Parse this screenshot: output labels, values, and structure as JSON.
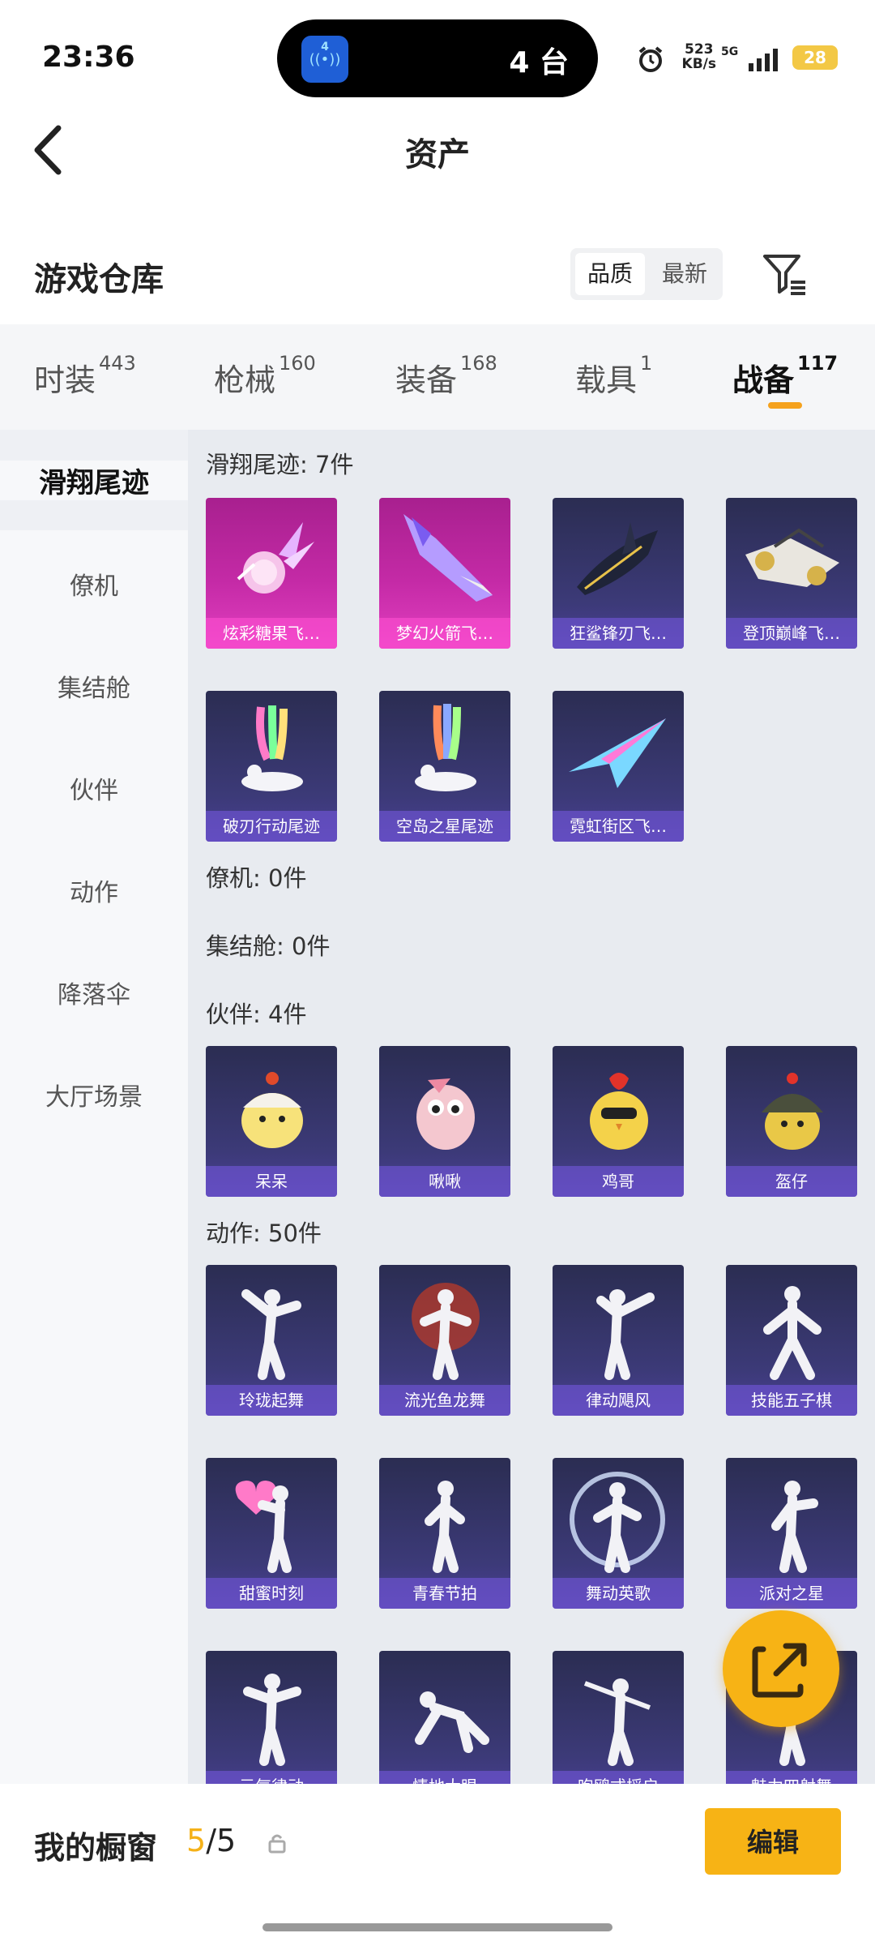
{
  "status_bar": {
    "time": "23:36",
    "island_icon_num": "4",
    "island_text": "4 台",
    "net_speed_value": "523",
    "net_speed_unit": "KB/s",
    "network": "5G",
    "battery": "28"
  },
  "header": {
    "title": "资产"
  },
  "warehouse": {
    "title": "游戏仓库",
    "sort_options": [
      "品质",
      "最新"
    ],
    "sort_active": "品质"
  },
  "tabs": [
    {
      "label": "时装",
      "count": "443"
    },
    {
      "label": "枪械",
      "count": "160"
    },
    {
      "label": "装备",
      "count": "168"
    },
    {
      "label": "载具",
      "count": "1"
    },
    {
      "label": "战备",
      "count": "117",
      "active": true
    }
  ],
  "side_nav": [
    {
      "label": "滑翔尾迹",
      "active": true
    },
    {
      "label": "僚机"
    },
    {
      "label": "集结舱"
    },
    {
      "label": "伙伴"
    },
    {
      "label": "动作"
    },
    {
      "label": "降落伞"
    },
    {
      "label": "大厅场景"
    }
  ],
  "sections": [
    {
      "header": "滑翔尾迹: 7件",
      "items": [
        "炫彩糖果飞…",
        "梦幻火箭飞…",
        "狂鲨锋刃飞…",
        "登顶巅峰飞…",
        "破刃行动尾迹",
        "空岛之星尾迹",
        "霓虹街区飞…"
      ]
    },
    {
      "header": "僚机: 0件",
      "items": []
    },
    {
      "header": "集结舱: 0件",
      "items": []
    },
    {
      "header": "伙伴: 4件",
      "items": [
        "呆呆",
        "啾啾",
        "鸡哥",
        "盔仔"
      ]
    },
    {
      "header": "动作: 50件",
      "items": [
        "玲珑起舞",
        "流光鱼龙舞",
        "律动飓风",
        "技能五子棋",
        "甜蜜时刻",
        "青春节拍",
        "舞动英歌",
        "派对之星",
        "元气律动",
        "情地大眼",
        "咆鸥式摇启",
        "魅力四射舞"
      ]
    }
  ],
  "bottom": {
    "showcase_label": "我的橱窗",
    "used": "5",
    "total": "/5",
    "edit_label": "编辑"
  },
  "colors": {
    "accent": "#f7b315",
    "tab_underline": "#f5a21d",
    "card_purple": "#3c3a78",
    "card_pink": "#c42aa6"
  }
}
